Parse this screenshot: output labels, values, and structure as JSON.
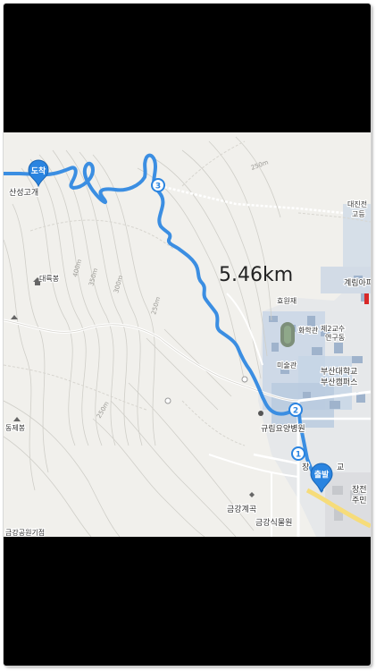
{
  "map": {
    "distance": "5.46km",
    "markers": {
      "start": "출발",
      "end": "도착",
      "waypoints": [
        "1",
        "2",
        "3"
      ]
    },
    "places": {
      "sanseong_gate": "산성고개",
      "daeryukbong": "대륙봉",
      "dongjebong": "동제봉",
      "hyowonjae": "효원재",
      "hwahakgwan": "화학관",
      "misulgwan": "미술관",
      "geumgang_gyegok": "금강계곡",
      "geumgang_park_center": "금강공원기점",
      "geumgang_botanical": "금강식물원",
      "kyurim_hospital": "규림요양병원",
      "pusan_univ": "부산대학교",
      "busan_campus": "부산캠퍼스",
      "second_faculty": "제2교수",
      "faculty_building": "연구동",
      "gyerim_apt": "계림아파",
      "daejin_high_1": "대진전",
      "daejin_high_2": "고등",
      "jangjeon_1": "장전",
      "jangjeon_2": "주민",
      "jang_school_a": "장",
      "jang_school_b": "교"
    },
    "contours": [
      "250m",
      "400m",
      "350m",
      "300m",
      "250m",
      "250m"
    ],
    "colors": {
      "route": "#3b8ee2",
      "marker": "#2a84e0",
      "road": "#ffffff",
      "contour": "#c9c8c2",
      "campus": "#c5d4e6"
    }
  }
}
